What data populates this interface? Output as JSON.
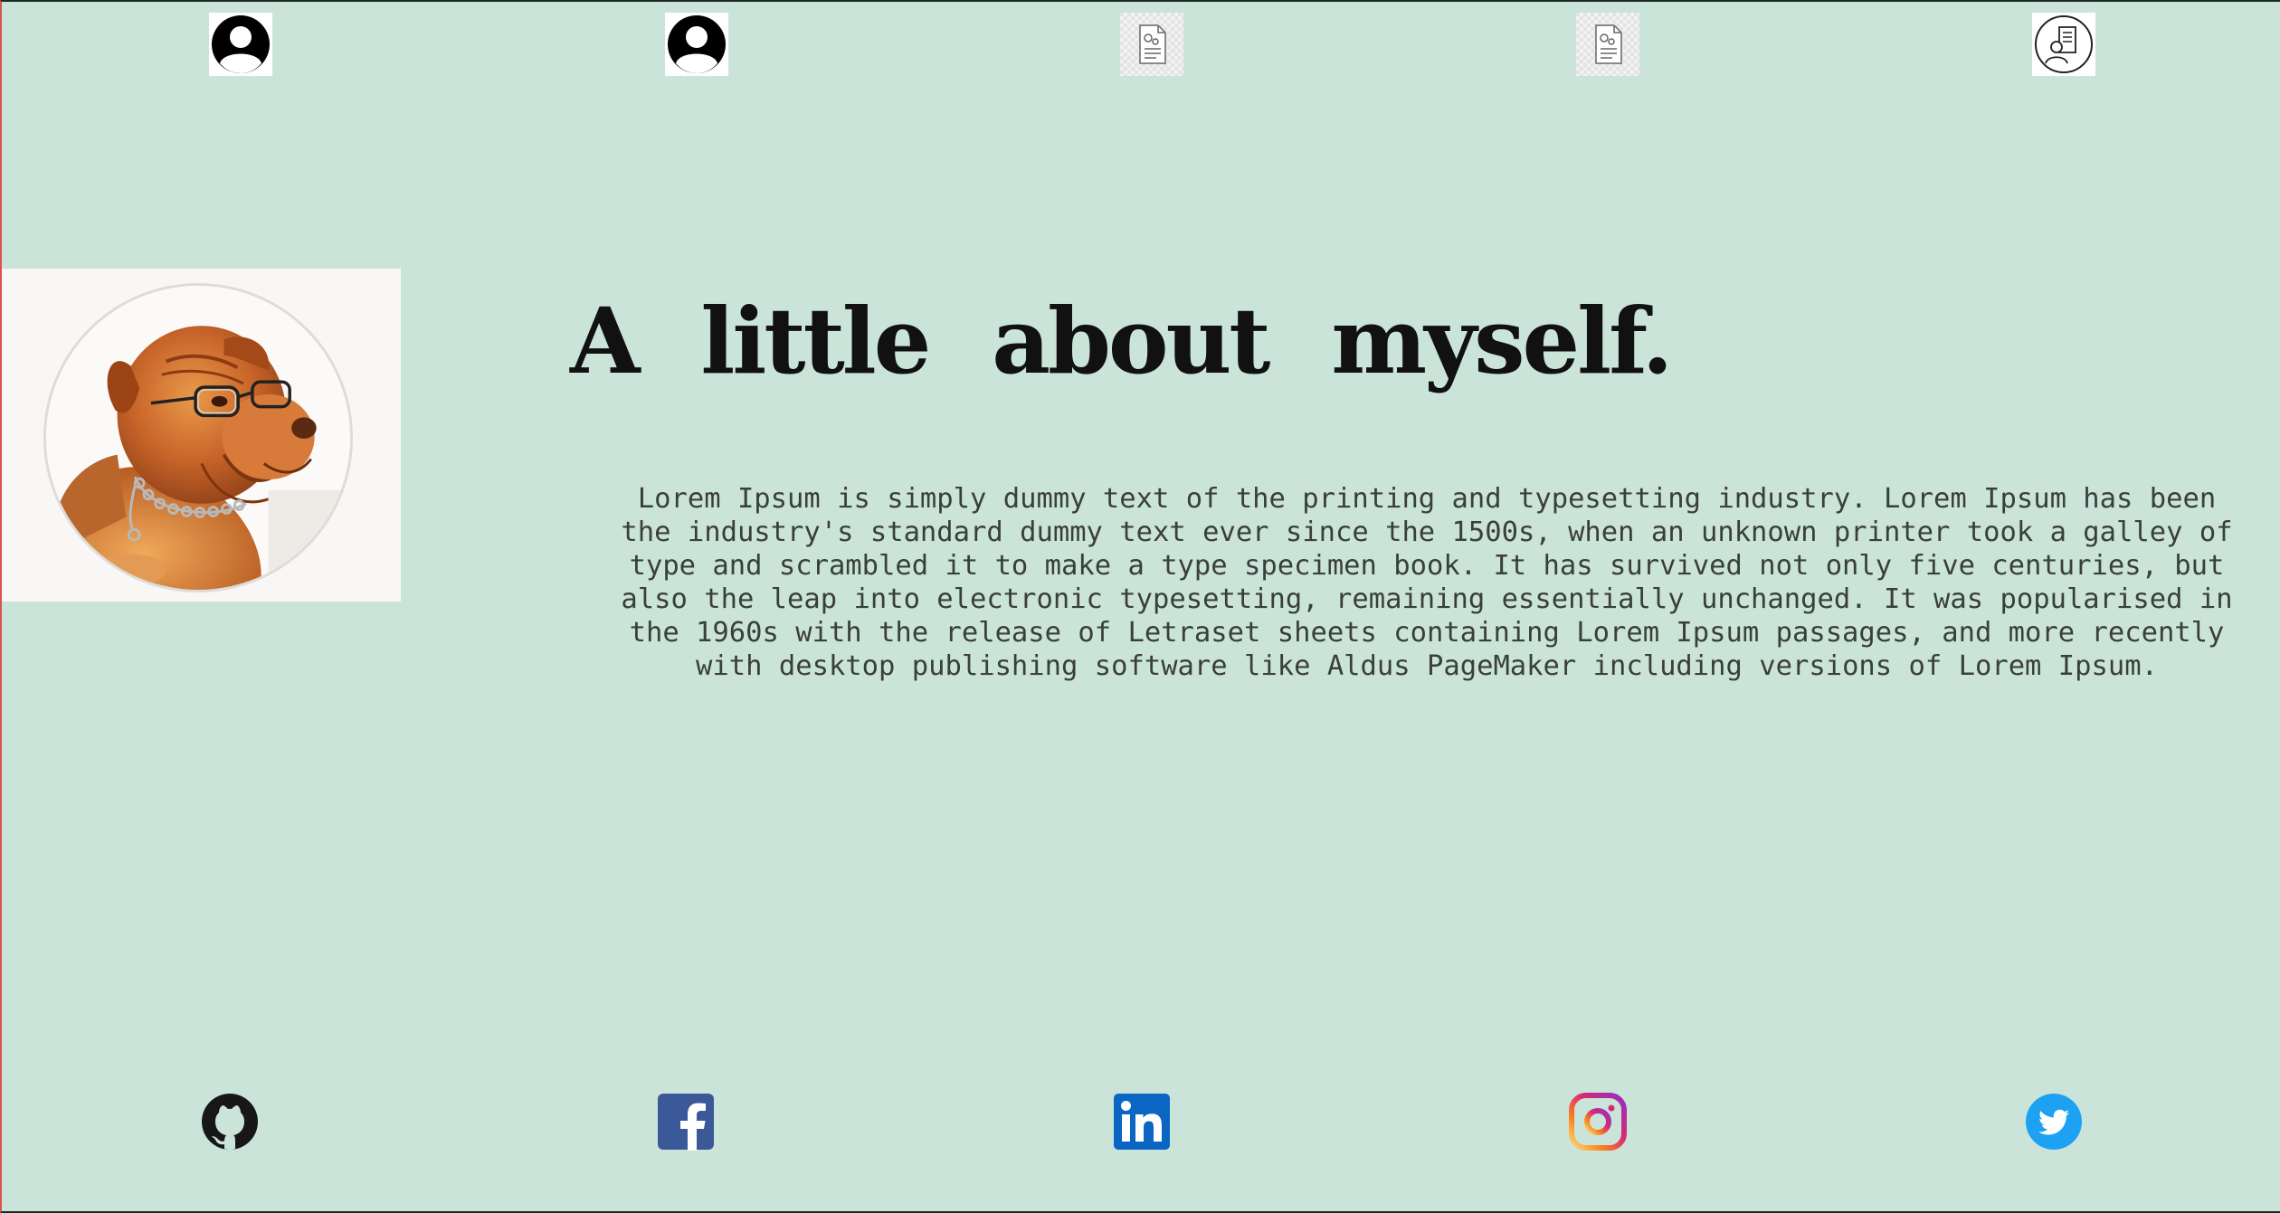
{
  "nav": {
    "items": [
      {
        "icon": "user-avatar-icon"
      },
      {
        "icon": "user-avatar-icon"
      },
      {
        "icon": "document-settings-icon"
      },
      {
        "icon": "document-settings-icon"
      },
      {
        "icon": "resume-contact-icon"
      }
    ]
  },
  "profile": {
    "image": "dog-with-glasses-photo"
  },
  "about": {
    "title": "A little about myself.",
    "body": "Lorem Ipsum is simply dummy text of the printing and typesetting industry. Lorem Ipsum has been the industry's standard dummy text ever since the 1500s, when an unknown printer took a galley of type and scrambled it to make a type specimen book. It has survived not only five centuries, but also the leap into electronic typesetting, remaining essentially unchanged. It was popularised in the 1960s with the release of Letraset sheets containing Lorem Ipsum passages, and more recently with desktop publishing software like Aldus PageMaker including versions of Lorem Ipsum."
  },
  "social": {
    "items": [
      {
        "icon": "github-icon",
        "color": "#181717"
      },
      {
        "icon": "facebook-icon",
        "color": "#3b5998"
      },
      {
        "icon": "linkedin-icon",
        "color": "#0a66c2"
      },
      {
        "icon": "instagram-icon",
        "color": "#e1306c"
      },
      {
        "icon": "twitter-icon",
        "color": "#1da1f2"
      }
    ]
  },
  "colors": {
    "background": "#cbe4d9",
    "text": "#3a3f3c",
    "heading": "#111111"
  }
}
